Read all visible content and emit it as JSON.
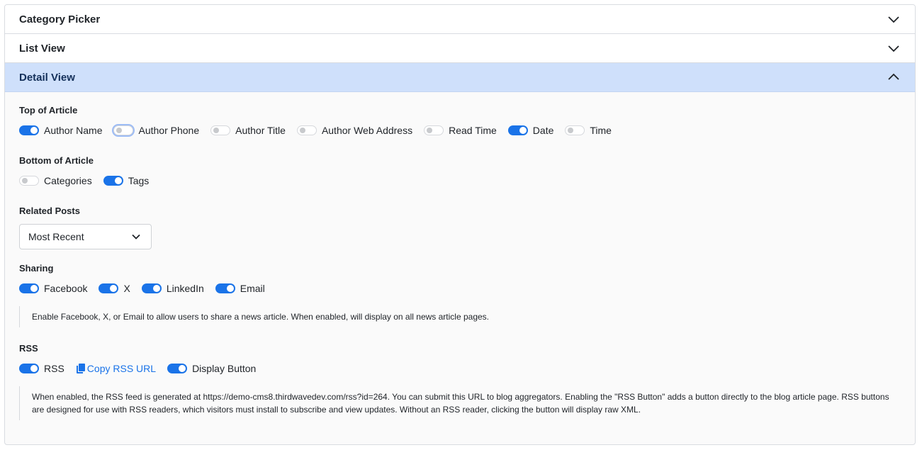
{
  "accordion": {
    "sections": [
      {
        "title": "Category Picker",
        "expanded": false
      },
      {
        "title": "List View",
        "expanded": false
      },
      {
        "title": "Detail View",
        "expanded": true
      }
    ]
  },
  "detail": {
    "top_of_article": {
      "label": "Top of Article",
      "toggles": [
        {
          "label": "Author Name",
          "on": true
        },
        {
          "label": "Author Phone",
          "on": false
        },
        {
          "label": "Author Title",
          "on": false
        },
        {
          "label": "Author Web Address",
          "on": false
        },
        {
          "label": "Read Time",
          "on": false
        },
        {
          "label": "Date",
          "on": true
        },
        {
          "label": "Time",
          "on": false
        }
      ]
    },
    "bottom_of_article": {
      "label": "Bottom of Article",
      "toggles": [
        {
          "label": "Categories",
          "on": false
        },
        {
          "label": "Tags",
          "on": true
        }
      ]
    },
    "related_posts": {
      "label": "Related Posts",
      "selected": "Most Recent"
    },
    "sharing": {
      "label": "Sharing",
      "toggles": [
        {
          "label": "Facebook",
          "on": true
        },
        {
          "label": "X",
          "on": true
        },
        {
          "label": "LinkedIn",
          "on": true
        },
        {
          "label": "Email",
          "on": true
        }
      ],
      "note": "Enable Facebook, X, or Email to allow users to share a news article. When enabled, will display on all news article pages."
    },
    "rss": {
      "label": "RSS",
      "rss_toggle": {
        "label": "RSS",
        "on": true
      },
      "copy_link": "Copy RSS URL",
      "display_toggle": {
        "label": "Display Button",
        "on": true
      },
      "note": "When enabled, the RSS feed is generated at https://demo-cms8.thirdwavedev.com/rss?id=264. You can submit this URL to blog aggregators. Enabling the \"RSS Button\" adds a button directly to the blog article page. RSS buttons are designed for use with RSS readers, which visitors must install to subscribe and view updates. Without an RSS reader, clicking the button will display raw XML."
    }
  },
  "colors": {
    "accent": "#1a73e8",
    "active_header": "#cfe0fb"
  }
}
